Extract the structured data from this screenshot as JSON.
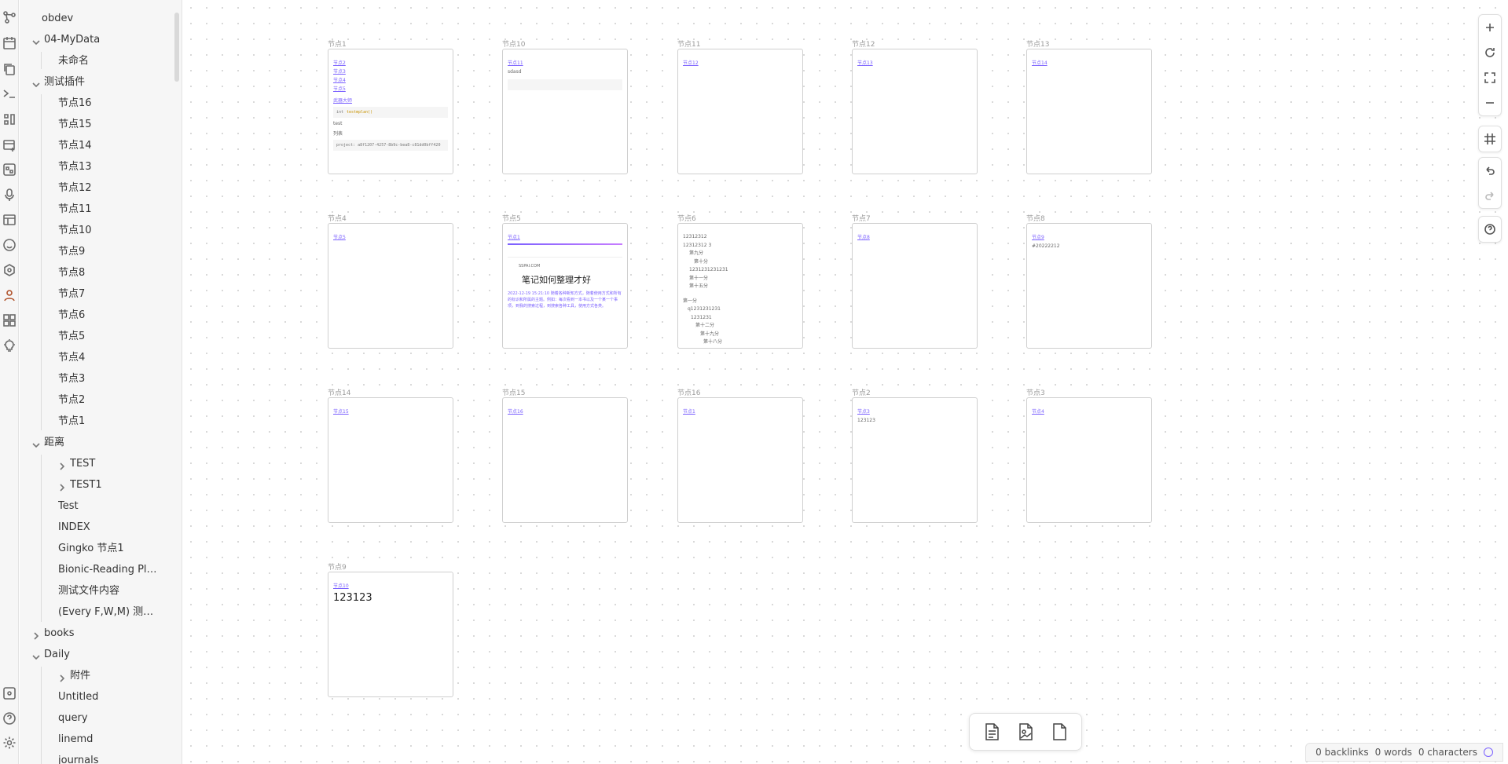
{
  "ribbon": {
    "icons": [
      "graph-icon",
      "calendar-icon",
      "copy-icon",
      "terminal-icon",
      "template-icon",
      "add-panel-icon",
      "canvas-icon",
      "microphone-icon",
      "table-icon",
      "smile-icon",
      "hexagon-icon",
      "user-icon",
      "dashboard-icon",
      "lightbulb-icon"
    ],
    "bottom_icons": [
      "vault-icon",
      "help-icon",
      "settings-icon"
    ]
  },
  "sidebar": {
    "vault_name": "obdev",
    "items": [
      {
        "label": "04-MyData",
        "type": "folder",
        "depth": 0,
        "expanded": true
      },
      {
        "label": "未命名",
        "type": "file",
        "depth": 1
      },
      {
        "label": "测试插件",
        "type": "folder",
        "depth": 0,
        "expanded": true
      },
      {
        "label": "节点16",
        "type": "file",
        "depth": 1
      },
      {
        "label": "节点15",
        "type": "file",
        "depth": 1
      },
      {
        "label": "节点14",
        "type": "file",
        "depth": 1
      },
      {
        "label": "节点13",
        "type": "file",
        "depth": 1
      },
      {
        "label": "节点12",
        "type": "file",
        "depth": 1
      },
      {
        "label": "节点11",
        "type": "file",
        "depth": 1
      },
      {
        "label": "节点10",
        "type": "file",
        "depth": 1
      },
      {
        "label": "节点9",
        "type": "file",
        "depth": 1
      },
      {
        "label": "节点8",
        "type": "file",
        "depth": 1
      },
      {
        "label": "节点7",
        "type": "file",
        "depth": 1
      },
      {
        "label": "节点6",
        "type": "file",
        "depth": 1
      },
      {
        "label": "节点5",
        "type": "file",
        "depth": 1
      },
      {
        "label": "节点4",
        "type": "file",
        "depth": 1
      },
      {
        "label": "节点3",
        "type": "file",
        "depth": 1
      },
      {
        "label": "节点2",
        "type": "file",
        "depth": 1
      },
      {
        "label": "节点1",
        "type": "file",
        "depth": 1
      },
      {
        "label": "距离",
        "type": "folder",
        "depth": 0,
        "expanded": true
      },
      {
        "label": "TEST",
        "type": "folder",
        "depth": 1,
        "expanded": false
      },
      {
        "label": "TEST1",
        "type": "folder",
        "depth": 1,
        "expanded": false
      },
      {
        "label": "Test",
        "type": "file",
        "depth": 1
      },
      {
        "label": "INDEX",
        "type": "file",
        "depth": 1
      },
      {
        "label": "Gingko 节点1",
        "type": "file",
        "depth": 1
      },
      {
        "label": "Bionic-Reading Pl…",
        "type": "file",
        "depth": 1
      },
      {
        "label": "测试文件内容",
        "type": "file",
        "depth": 1
      },
      {
        "label": "(Every F,W,M) 测…",
        "type": "file",
        "depth": 1
      },
      {
        "label": "books",
        "type": "folder",
        "depth": 0,
        "expanded": false
      },
      {
        "label": "Daily",
        "type": "folder",
        "depth": 0,
        "expanded": true
      },
      {
        "label": "附件",
        "type": "folder",
        "depth": 1,
        "expanded": false
      },
      {
        "label": "Untitled",
        "type": "file",
        "depth": 1
      },
      {
        "label": "query",
        "type": "file",
        "depth": 1
      },
      {
        "label": "linemd",
        "type": "file",
        "depth": 1
      },
      {
        "label": "journals",
        "type": "file",
        "depth": 1
      }
    ]
  },
  "canvas": {
    "nodes": [
      {
        "title": "节点1",
        "links": [
          "节点2",
          "节点3",
          "节点4",
          "节点5"
        ],
        "extra_link": "武器大师",
        "code_kw": "int",
        "code_fn": "testmplan()",
        "lines": [
          "test",
          "列表"
        ],
        "code2": "project: a8f1207-4257-8b9c-bea8-c81dd0bff420"
      },
      {
        "title": "节点10",
        "links": [
          "节点11"
        ],
        "lines": [
          "sdasd"
        ]
      },
      {
        "title": "节点11",
        "links": [
          "节点12"
        ]
      },
      {
        "title": "节点12",
        "links": [
          "节点13"
        ]
      },
      {
        "title": "节点13",
        "links": [
          "节点14"
        ]
      },
      {
        "title": "节点4",
        "links": [
          "节点5"
        ]
      },
      {
        "title": "节点5",
        "links": [
          "节点1"
        ],
        "web_domain": "SSPAI.COM",
        "web_title": "笔记如何整理才好",
        "web_text": "2022-12-19 15:21:10 随着各种新知方式，随着使用方式和所有的标识和所属的主题。例如：每次看到一本书以及一个某一个事项，到我的搜索过程，到搜索各种工具，使用方式各类。"
      },
      {
        "title": "节点6",
        "list": [
          "12312312",
          "12312312 3",
          "第九分",
          "第十分",
          "1231231231231",
          "第十一分",
          "第十五分",
          "第一分",
          "q1231231231",
          "1231231",
          "第十二分",
          "第十九分",
          "第十八分"
        ]
      },
      {
        "title": "节点7",
        "links": [
          "节点8"
        ]
      },
      {
        "title": "节点8",
        "links": [
          "节点9"
        ],
        "lines": [
          "#20222212"
        ]
      },
      {
        "title": "节点14",
        "links": [
          "节点15"
        ]
      },
      {
        "title": "节点15",
        "links": [
          "节点16"
        ]
      },
      {
        "title": "节点16",
        "links": [
          "节点1"
        ]
      },
      {
        "title": "节点2",
        "links": [
          "节点3"
        ],
        "lines": [
          "123123"
        ]
      },
      {
        "title": "节点3",
        "links": [
          "节点4"
        ]
      },
      {
        "title": "节点9",
        "links": [
          "节点10"
        ],
        "big": "123123"
      }
    ]
  },
  "controls": [
    "zoom-in-icon",
    "reset-icon",
    "fit-icon",
    "zoom-out-icon",
    "snap-grid-icon",
    "undo-icon",
    "redo-icon",
    "help-icon"
  ],
  "bottom_tools": [
    "add-note-icon",
    "add-media-icon",
    "add-file-icon"
  ],
  "status": {
    "backlinks": "0 backlinks",
    "words": "0 words",
    "characters": "0 characters"
  }
}
